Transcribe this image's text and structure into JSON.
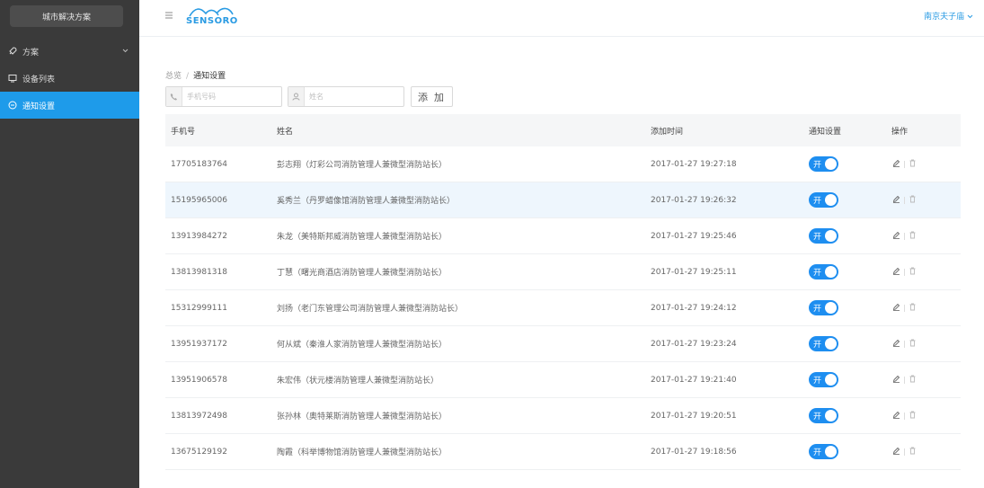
{
  "sidebar": {
    "brand": "城市解决方案",
    "items": [
      {
        "label": "方案",
        "icon": "rocket-icon",
        "expandable": true
      },
      {
        "label": "设备列表",
        "icon": "monitor-icon"
      },
      {
        "label": "通知设置",
        "icon": "bell-icon",
        "active": true
      }
    ]
  },
  "header": {
    "logo": "SENSORO",
    "user": "南京夫子庙"
  },
  "breadcrumb": {
    "root": "总览",
    "separator": "/",
    "current": "通知设置"
  },
  "form": {
    "phone_placeholder": "手机号码",
    "name_placeholder": "姓名",
    "add_label": "添 加"
  },
  "table": {
    "headers": [
      "手机号",
      "姓名",
      "添加时间",
      "通知设置",
      "操作"
    ],
    "toggle_label": "开",
    "rows": [
      {
        "phone": "17705183764",
        "name": "彭志翔（灯彩公司消防管理人兼微型消防站长）",
        "time": "2017-01-27 19:27:18",
        "enabled": true
      },
      {
        "phone": "15195965006",
        "name": "奚秀兰（丹罗蜡像馆消防管理人兼微型消防站长）",
        "time": "2017-01-27 19:26:32",
        "enabled": true
      },
      {
        "phone": "13913984272",
        "name": "朱龙（美特斯邦威消防管理人兼微型消防站长）",
        "time": "2017-01-27 19:25:46",
        "enabled": true
      },
      {
        "phone": "13813981318",
        "name": "丁慧（曙光商酒店消防管理人兼微型消防站长）",
        "time": "2017-01-27 19:25:11",
        "enabled": true
      },
      {
        "phone": "15312999111",
        "name": "刘扬（老门东管理公司消防管理人兼微型消防站长）",
        "time": "2017-01-27 19:24:12",
        "enabled": true
      },
      {
        "phone": "13951937172",
        "name": "何从斌（秦淮人家消防管理人兼微型消防站长）",
        "time": "2017-01-27 19:23:24",
        "enabled": true
      },
      {
        "phone": "13951906578",
        "name": "朱宏伟（状元楼消防管理人兼微型消防站长）",
        "time": "2017-01-27 19:21:40",
        "enabled": true
      },
      {
        "phone": "13813972498",
        "name": "张孙林（奥特莱斯消防管理人兼微型消防站长）",
        "time": "2017-01-27 19:20:51",
        "enabled": true
      },
      {
        "phone": "13675129192",
        "name": "陶霞（科举博物馆消防管理人兼微型消防站长）",
        "time": "2017-01-27 19:18:56",
        "enabled": true
      }
    ]
  },
  "colors": {
    "sidebar_bg": "#3a3a3a",
    "accent": "#1e9bea",
    "toggle_on": "#1e8ef0",
    "row_highlight": "#eef6fd"
  }
}
